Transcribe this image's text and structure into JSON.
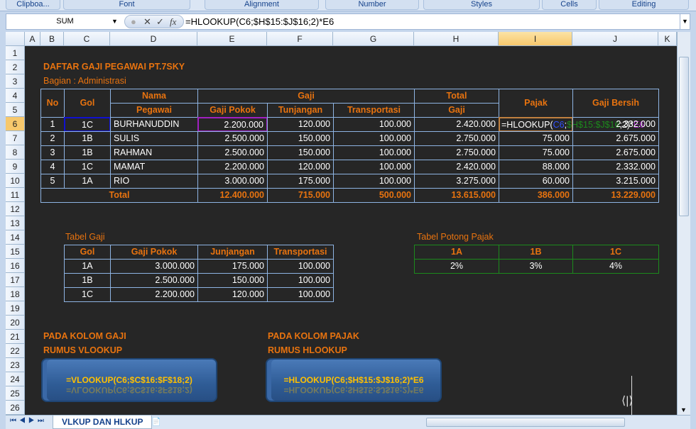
{
  "ribbon": {
    "groups": [
      "Clipboa...",
      "Font",
      "Alignment",
      "Number",
      "Styles",
      "Cells",
      "Editing"
    ]
  },
  "formula_bar": {
    "name_box": "SUM",
    "cancel": "✕",
    "enter": "✓",
    "fx": "fx",
    "formula": "=HLOOKUP(C6;$H$15:$J$16;2)*E6"
  },
  "columns": [
    "A",
    "B",
    "C",
    "D",
    "E",
    "F",
    "G",
    "H",
    "I",
    "J",
    "K"
  ],
  "rows": [
    "1",
    "2",
    "3",
    "4",
    "5",
    "6",
    "7",
    "8",
    "9",
    "10",
    "11",
    "12",
    "13",
    "14",
    "15",
    "16",
    "17",
    "18",
    "19",
    "20",
    "21",
    "22",
    "23",
    "24",
    "25",
    "26"
  ],
  "title": "DAFTAR GAJI PEGAWAI PT.7SKY",
  "subtitle": "Bagian : Administrasi",
  "main_table": {
    "headers": {
      "no": "No",
      "gol": "Gol",
      "nama": "Nama",
      "pegawai": "Pegawai",
      "gaji": "Gaji",
      "gaji_pokok": "Gaji Pokok",
      "tunjangan": "Tunjangan",
      "transportasi": "Transportasi",
      "total": "Total",
      "total_gaji": "Gaji",
      "pajak": "Pajak",
      "gaji_bersih": "Gaji Bersih"
    },
    "rows": [
      [
        "1",
        "1C",
        "BURHANUDDIN",
        "2.200.000",
        "120.000",
        "100.000",
        "2.420.000",
        "",
        "2.332.000"
      ],
      [
        "2",
        "1B",
        "SULIS",
        "2.500.000",
        "150.000",
        "100.000",
        "2.750.000",
        "75.000",
        "2.675.000"
      ],
      [
        "3",
        "1B",
        "RAHMAN",
        "2.500.000",
        "150.000",
        "100.000",
        "2.750.000",
        "75.000",
        "2.675.000"
      ],
      [
        "4",
        "1C",
        "MAMAT",
        "2.200.000",
        "120.000",
        "100.000",
        "2.420.000",
        "88.000",
        "2.332.000"
      ],
      [
        "5",
        "1A",
        "RIO",
        "3.000.000",
        "175.000",
        "100.000",
        "3.275.000",
        "60.000",
        "3.215.000"
      ]
    ],
    "editing": {
      "p1": "=HLOOKUP(",
      "p2": "C6",
      "p3": ";",
      "p4": "$H$15:$J$16",
      "p5": ";2)*",
      "p6": "E6"
    },
    "total": {
      "label": "Total",
      "values": [
        "12.400.000",
        "715.000",
        "500.000",
        "13.615.000",
        "386.000",
        "13.229.000"
      ]
    }
  },
  "tabel_gaji": {
    "title": "Tabel Gaji",
    "headers": [
      "Gol",
      "Gaji Pokok",
      "Junjangan",
      "Transportasi"
    ],
    "rows": [
      [
        "1A",
        "3.000.000",
        "175.000",
        "100.000"
      ],
      [
        "1B",
        "2.500.000",
        "150.000",
        "100.000"
      ],
      [
        "1C",
        "2.200.000",
        "120.000",
        "100.000"
      ]
    ]
  },
  "tabel_pajak": {
    "title": "Tabel Potong Pajak",
    "headers": [
      "1A",
      "1B",
      "1C"
    ],
    "values": [
      "2%",
      "3%",
      "4%"
    ]
  },
  "notes": {
    "gaji_1": "PADA KOLOM GAJI",
    "gaji_2": "RUMUS VLOOKUP",
    "pajak_1": "PADA KOLOM PAJAK",
    "pajak_2": "RUMUS HLOOKUP"
  },
  "shapes": {
    "vlookup": "=VLOOKUP(C6;$C$16:$F$18;2)",
    "hlookup": "=HLOOKUP(C6;$H$15:$J$16;2)*E6"
  },
  "sheet_tabs": {
    "active": "VLKUP DAN HLKUP"
  },
  "colors": {
    "accent": "#e8730f",
    "border": "#8eb4e3",
    "sheet_bg": "#262626"
  }
}
